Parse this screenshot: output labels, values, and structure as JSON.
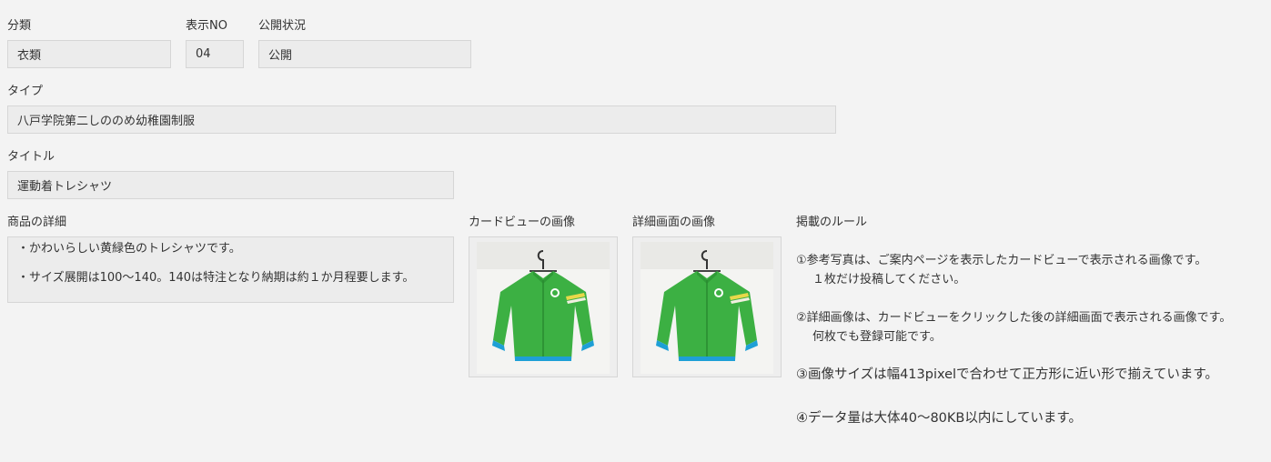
{
  "fields": {
    "category": {
      "label": "分類",
      "value": "衣類"
    },
    "display_no": {
      "label": "表示NO",
      "value": "04"
    },
    "publish_status": {
      "label": "公開状況",
      "value": "公開"
    },
    "type": {
      "label": "タイプ",
      "value": "八戸学院第二しののめ幼稚園制服"
    },
    "title": {
      "label": "タイトル",
      "value": "運動着トレシャツ"
    },
    "details": {
      "label": "商品の詳細",
      "lines": [
        "・かわいらしい黄緑色のトレシャツです。",
        "・サイズ展開は100～140。140は特注となり納期は約１か月程要します。"
      ]
    }
  },
  "images": {
    "card_view": {
      "label": "カードビューの画像",
      "icon": "green-track-jacket-photo"
    },
    "detail_view": {
      "label": "詳細画面の画像",
      "icon": "green-track-jacket-photo"
    }
  },
  "rules": {
    "heading": "掲載のルール",
    "items": [
      {
        "line1": "①参考写真は、ご案内ページを表示したカードビューで表示される画像です。",
        "line2": "１枚だけ投稿してください。"
      },
      {
        "line1": "②詳細画像は、カードビューをクリックした後の詳細画面で表示される画像です。",
        "line2": "何枚でも登録可能です。"
      },
      {
        "line1": "③画像サイズは幅413pixelで合わせて正方形に近い形で揃えています。"
      },
      {
        "line1": "④データ量は大体40～80KB以内にしています。"
      }
    ]
  },
  "colors": {
    "background": "#f3f3f3",
    "field_background": "#ececec",
    "field_border": "#d6d6d6",
    "jacket_green": "#3cb043",
    "jacket_stripe": "#e8d84a",
    "cuff_blue": "#1e9fd6"
  }
}
